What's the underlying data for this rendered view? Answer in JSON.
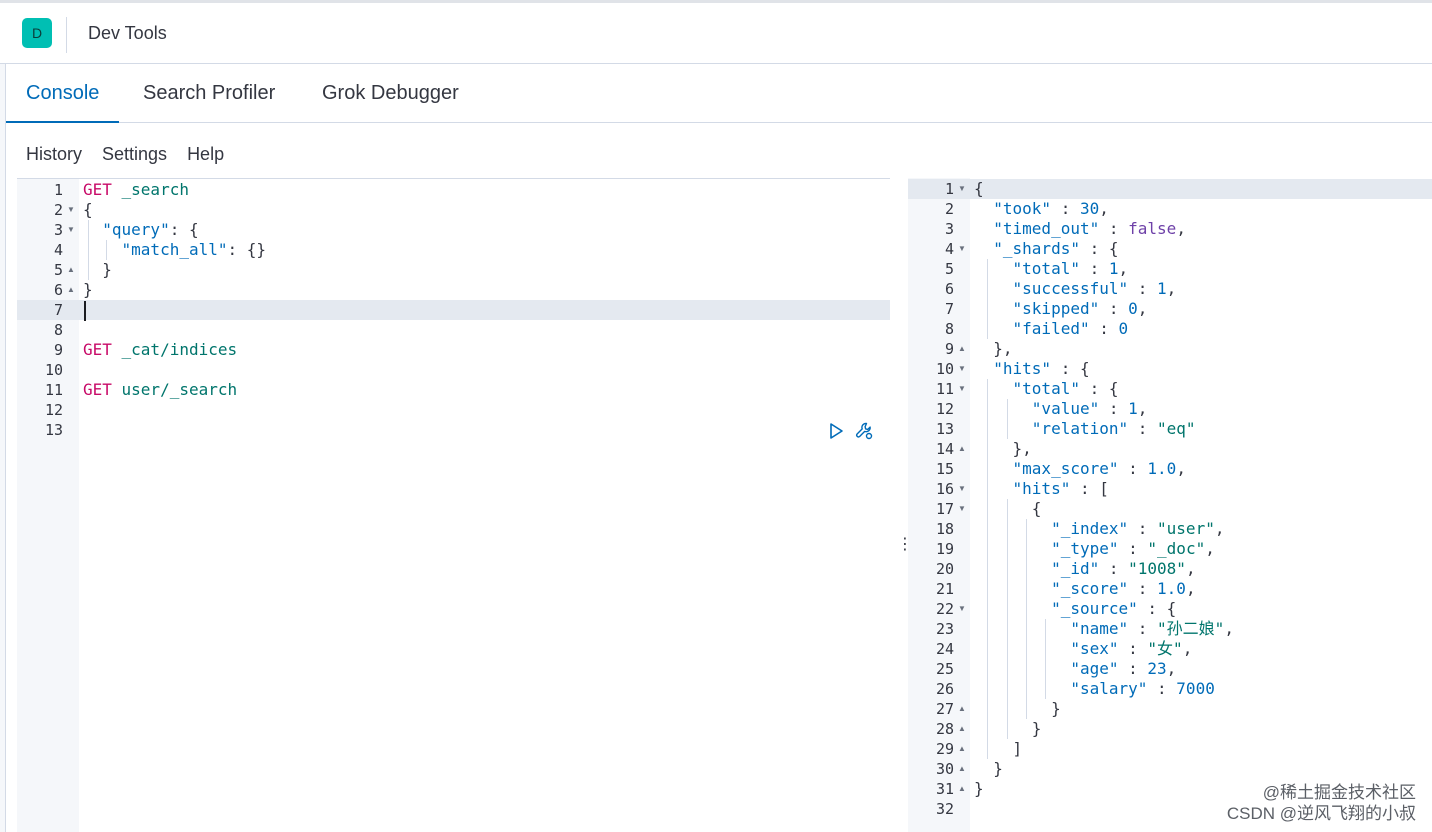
{
  "app": {
    "avatar_letter": "D",
    "title": "Dev Tools"
  },
  "tabs": [
    {
      "label": "Console",
      "active": true
    },
    {
      "label": "Search Profiler",
      "active": false
    },
    {
      "label": "Grok Debugger",
      "active": false
    }
  ],
  "menu": [
    "History",
    "Settings",
    "Help"
  ],
  "request_editor": {
    "line_numbers": [
      "1",
      "2",
      "3",
      "4",
      "5",
      "6",
      "7",
      "8",
      "9",
      "10",
      "11",
      "12",
      "13"
    ],
    "lines": [
      [
        [
          "kw",
          "GET "
        ],
        [
          "url",
          "_search"
        ]
      ],
      [
        [
          "punc",
          "{"
        ]
      ],
      [
        [
          "punc",
          "  "
        ],
        [
          "key",
          "\"query\""
        ],
        [
          "punc",
          ": {"
        ]
      ],
      [
        [
          "punc",
          "    "
        ],
        [
          "key",
          "\"match_all\""
        ],
        [
          "punc",
          ": {}"
        ]
      ],
      [
        [
          "punc",
          "  }"
        ]
      ],
      [
        [
          "punc",
          "}"
        ]
      ],
      [],
      [],
      [
        [
          "kw",
          "GET "
        ],
        [
          "url",
          "_cat/indices"
        ]
      ],
      [],
      [
        [
          "kw",
          "GET "
        ],
        [
          "url",
          "user/_search"
        ]
      ],
      [],
      []
    ],
    "fold_lines": {
      "2": "down",
      "3": "down",
      "5": "up",
      "6": "up"
    },
    "active_line": 7,
    "run_icon": "play-icon",
    "wrench_icon": "wrench-icon"
  },
  "response_viewer": {
    "line_numbers": [
      "1",
      "2",
      "3",
      "4",
      "5",
      "6",
      "7",
      "8",
      "9",
      "10",
      "11",
      "12",
      "13",
      "14",
      "15",
      "16",
      "17",
      "18",
      "19",
      "20",
      "21",
      "22",
      "23",
      "24",
      "25",
      "26",
      "27",
      "28",
      "29",
      "30",
      "31",
      "32"
    ],
    "lines": [
      [
        [
          "punc",
          "{"
        ]
      ],
      [
        [
          "punc",
          "  "
        ],
        [
          "key",
          "\"took\""
        ],
        [
          "punc",
          " : "
        ],
        [
          "num",
          "30"
        ],
        [
          "punc",
          ","
        ]
      ],
      [
        [
          "punc",
          "  "
        ],
        [
          "key",
          "\"timed_out\""
        ],
        [
          "punc",
          " : "
        ],
        [
          "bool",
          "false"
        ],
        [
          "punc",
          ","
        ]
      ],
      [
        [
          "punc",
          "  "
        ],
        [
          "key",
          "\"_shards\""
        ],
        [
          "punc",
          " : {"
        ]
      ],
      [
        [
          "punc",
          "    "
        ],
        [
          "key",
          "\"total\""
        ],
        [
          "punc",
          " : "
        ],
        [
          "num",
          "1"
        ],
        [
          "punc",
          ","
        ]
      ],
      [
        [
          "punc",
          "    "
        ],
        [
          "key",
          "\"successful\""
        ],
        [
          "punc",
          " : "
        ],
        [
          "num",
          "1"
        ],
        [
          "punc",
          ","
        ]
      ],
      [
        [
          "punc",
          "    "
        ],
        [
          "key",
          "\"skipped\""
        ],
        [
          "punc",
          " : "
        ],
        [
          "num",
          "0"
        ],
        [
          "punc",
          ","
        ]
      ],
      [
        [
          "punc",
          "    "
        ],
        [
          "key",
          "\"failed\""
        ],
        [
          "punc",
          " : "
        ],
        [
          "num",
          "0"
        ]
      ],
      [
        [
          "punc",
          "  },"
        ]
      ],
      [
        [
          "punc",
          "  "
        ],
        [
          "key",
          "\"hits\""
        ],
        [
          "punc",
          " : {"
        ]
      ],
      [
        [
          "punc",
          "    "
        ],
        [
          "key",
          "\"total\""
        ],
        [
          "punc",
          " : {"
        ]
      ],
      [
        [
          "punc",
          "      "
        ],
        [
          "key",
          "\"value\""
        ],
        [
          "punc",
          " : "
        ],
        [
          "num",
          "1"
        ],
        [
          "punc",
          ","
        ]
      ],
      [
        [
          "punc",
          "      "
        ],
        [
          "key",
          "\"relation\""
        ],
        [
          "punc",
          " : "
        ],
        [
          "str",
          "\"eq\""
        ]
      ],
      [
        [
          "punc",
          "    },"
        ]
      ],
      [
        [
          "punc",
          "    "
        ],
        [
          "key",
          "\"max_score\""
        ],
        [
          "punc",
          " : "
        ],
        [
          "num",
          "1.0"
        ],
        [
          "punc",
          ","
        ]
      ],
      [
        [
          "punc",
          "    "
        ],
        [
          "key",
          "\"hits\""
        ],
        [
          "punc",
          " : ["
        ]
      ],
      [
        [
          "punc",
          "      {"
        ]
      ],
      [
        [
          "punc",
          "        "
        ],
        [
          "key",
          "\"_index\""
        ],
        [
          "punc",
          " : "
        ],
        [
          "str",
          "\"user\""
        ],
        [
          "punc",
          ","
        ]
      ],
      [
        [
          "punc",
          "        "
        ],
        [
          "key",
          "\"_type\""
        ],
        [
          "punc",
          " : "
        ],
        [
          "str",
          "\"_doc\""
        ],
        [
          "punc",
          ","
        ]
      ],
      [
        [
          "punc",
          "        "
        ],
        [
          "key",
          "\"_id\""
        ],
        [
          "punc",
          " : "
        ],
        [
          "str",
          "\"1008\""
        ],
        [
          "punc",
          ","
        ]
      ],
      [
        [
          "punc",
          "        "
        ],
        [
          "key",
          "\"_score\""
        ],
        [
          "punc",
          " : "
        ],
        [
          "num",
          "1.0"
        ],
        [
          "punc",
          ","
        ]
      ],
      [
        [
          "punc",
          "        "
        ],
        [
          "key",
          "\"_source\""
        ],
        [
          "punc",
          " : {"
        ]
      ],
      [
        [
          "punc",
          "          "
        ],
        [
          "key",
          "\"name\""
        ],
        [
          "punc",
          " : "
        ],
        [
          "str",
          "\"孙二娘\""
        ],
        [
          "punc",
          ","
        ]
      ],
      [
        [
          "punc",
          "          "
        ],
        [
          "key",
          "\"sex\""
        ],
        [
          "punc",
          " : "
        ],
        [
          "str",
          "\"女\""
        ],
        [
          "punc",
          ","
        ]
      ],
      [
        [
          "punc",
          "          "
        ],
        [
          "key",
          "\"age\""
        ],
        [
          "punc",
          " : "
        ],
        [
          "num",
          "23"
        ],
        [
          "punc",
          ","
        ]
      ],
      [
        [
          "punc",
          "          "
        ],
        [
          "key",
          "\"salary\""
        ],
        [
          "punc",
          " : "
        ],
        [
          "num",
          "7000"
        ]
      ],
      [
        [
          "punc",
          "        }"
        ]
      ],
      [
        [
          "punc",
          "      }"
        ]
      ],
      [
        [
          "punc",
          "    ]"
        ]
      ],
      [
        [
          "punc",
          "  }"
        ]
      ],
      [
        [
          "punc",
          "}"
        ]
      ],
      []
    ],
    "fold_lines": {
      "1": "down",
      "4": "down",
      "9": "up",
      "10": "down",
      "11": "down",
      "14": "up",
      "16": "down",
      "17": "down",
      "22": "down",
      "27": "up",
      "28": "up",
      "29": "up",
      "30": "up",
      "31": "up"
    },
    "active_line": 1
  },
  "divider_icon": "vertical-dots-icon",
  "watermark": {
    "line1": "@稀土掘金技术社区",
    "line2": "CSDN @逆风飞翔的小叔"
  },
  "colors": {
    "accent": "#006bb8",
    "method": "#c80a68",
    "string": "#00756c",
    "boolean": "#6e41a8",
    "avatar_bg": "#00bfb3",
    "active_line_bg": "#e4e9f0"
  }
}
